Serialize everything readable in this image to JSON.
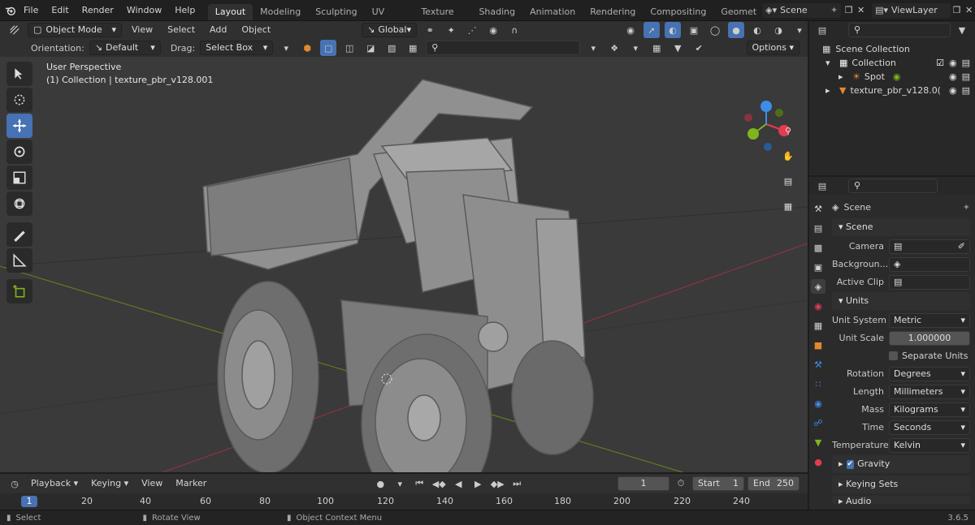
{
  "menus": [
    "File",
    "Edit",
    "Render",
    "Window",
    "Help"
  ],
  "workspaces": [
    "Layout",
    "Modeling",
    "Sculpting",
    "UV Editing",
    "Texture Paint",
    "Shading",
    "Animation",
    "Rendering",
    "Compositing",
    "Geometry Noc"
  ],
  "scene_name": "Scene",
  "view_layer": "ViewLayer",
  "header": {
    "mode": "Object Mode",
    "menus": [
      "View",
      "Select",
      "Add",
      "Object"
    ],
    "transform_orientation": "Global",
    "orientation_label": "Orientation:",
    "orientation_value": "Default",
    "drag_label": "Drag:",
    "drag_value": "Select Box",
    "options_label": "Options"
  },
  "viewport": {
    "perspective": "User Perspective",
    "collection_info": "(1) Collection | texture_pbr_v128.001",
    "gizmo_axes": [
      "X",
      "Y",
      "Z"
    ]
  },
  "outliner": {
    "root": "Scene Collection",
    "items": [
      {
        "label": "Collection",
        "level": 1
      },
      {
        "label": "Spot",
        "level": 2
      },
      {
        "label": "texture_pbr_v128.0(",
        "level": 1
      }
    ]
  },
  "properties": {
    "title": "Scene",
    "scene_panel": {
      "header": "Scene",
      "camera_label": "Camera",
      "background_label": "Backgroun...",
      "active_clip_label": "Active Clip"
    },
    "units_panel": {
      "header": "Units",
      "rows": [
        {
          "label": "Unit System",
          "value": "Metric"
        },
        {
          "label": "Unit Scale",
          "value": "1.000000"
        },
        {
          "label": "",
          "value": "Separate Units"
        },
        {
          "label": "Rotation",
          "value": "Degrees"
        },
        {
          "label": "Length",
          "value": "Millimeters"
        },
        {
          "label": "Mass",
          "value": "Kilograms"
        },
        {
          "label": "Time",
          "value": "Seconds"
        },
        {
          "label": "Temperature",
          "value": "Kelvin"
        }
      ]
    },
    "gravity_label": "Gravity",
    "keying_sets_label": "Keying Sets",
    "audio_label": "Audio"
  },
  "timeline": {
    "menus": [
      "Playback",
      "Keying",
      "View",
      "Marker"
    ],
    "current_frame": "1",
    "start_label": "Start",
    "start_value": "1",
    "end_label": "End",
    "end_value": "250",
    "ruler": [
      "1",
      "20",
      "40",
      "60",
      "80",
      "100",
      "120",
      "140",
      "160",
      "180",
      "200",
      "220",
      "240"
    ]
  },
  "status": {
    "select": "Select",
    "rotate": "Rotate View",
    "context": "Object Context Menu",
    "version": "3.6.5"
  },
  "colors": {
    "accent": "#4772b3",
    "x_axis": "#e23c52",
    "y_axis": "#7fb51d",
    "z_axis": "#3d8ee8"
  }
}
